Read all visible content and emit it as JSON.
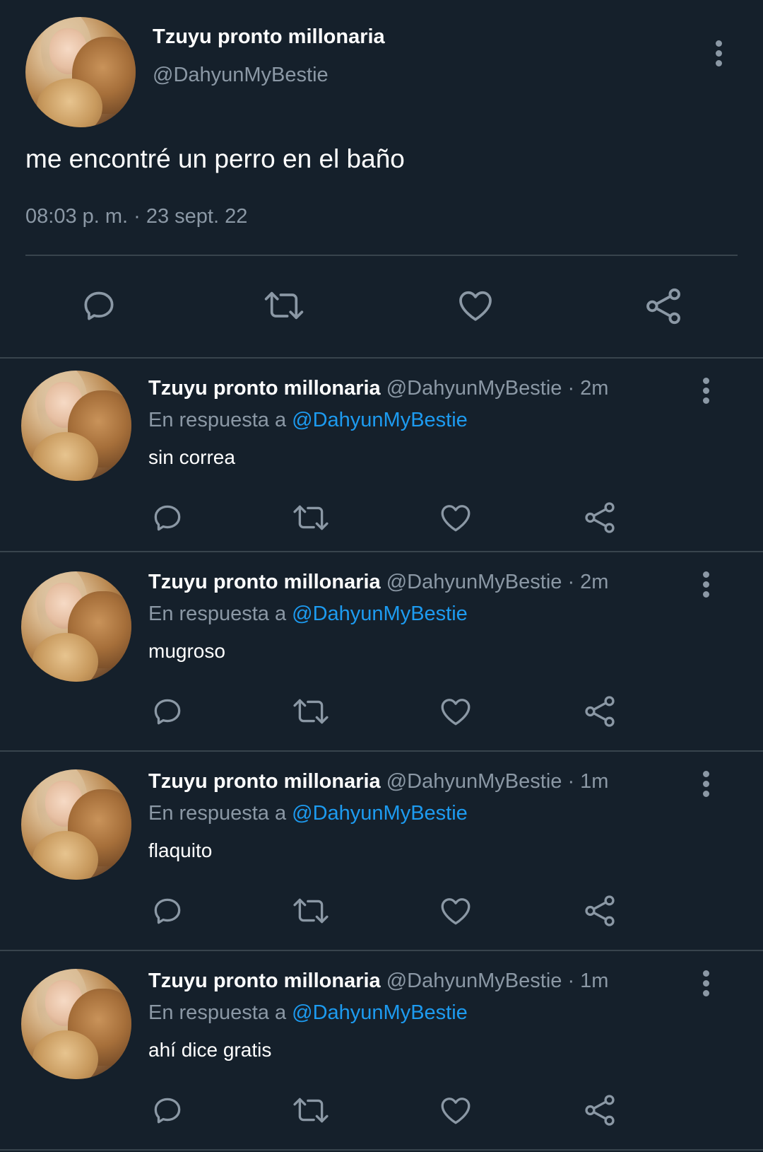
{
  "main_tweet": {
    "display_name": "Tzuyu pronto millonaria",
    "handle": "@DahyunMyBestie",
    "text": "me encontré un perro en el baño",
    "timestamp": "08:03 p. m. · 23 sept. 22",
    "more_icon": "more-vertical-icon",
    "actions": [
      "reply-icon",
      "retweet-icon",
      "like-icon",
      "share-icon"
    ]
  },
  "replies": [
    {
      "display_name": "Tzuyu pronto millonaria",
      "handle": "@DahyunMyBestie",
      "time": "· 2m",
      "in_reply_prefix": "En respuesta a",
      "in_reply_handle": "@DahyunMyBestie",
      "text": "sin correa"
    },
    {
      "display_name": "Tzuyu pronto millonaria",
      "handle": "@DahyunMyBestie",
      "time": "· 2m",
      "in_reply_prefix": "En respuesta a",
      "in_reply_handle": "@DahyunMyBestie",
      "text": "mugroso"
    },
    {
      "display_name": "Tzuyu pronto millonaria",
      "handle": "@DahyunMyBestie",
      "time": "· 1m",
      "in_reply_prefix": "En respuesta a",
      "in_reply_handle": "@DahyunMyBestie",
      "text": "flaquito"
    },
    {
      "display_name": "Tzuyu pronto millonaria",
      "handle": "@DahyunMyBestie",
      "time": "· 1m",
      "in_reply_prefix": "En respuesta a",
      "in_reply_handle": "@DahyunMyBestie",
      "text": "ahí dice gratis"
    }
  ],
  "colors": {
    "background": "#15202b",
    "text": "#ffffff",
    "muted": "#8b98a5",
    "link": "#1d9bf0",
    "divider": "#38444d"
  }
}
